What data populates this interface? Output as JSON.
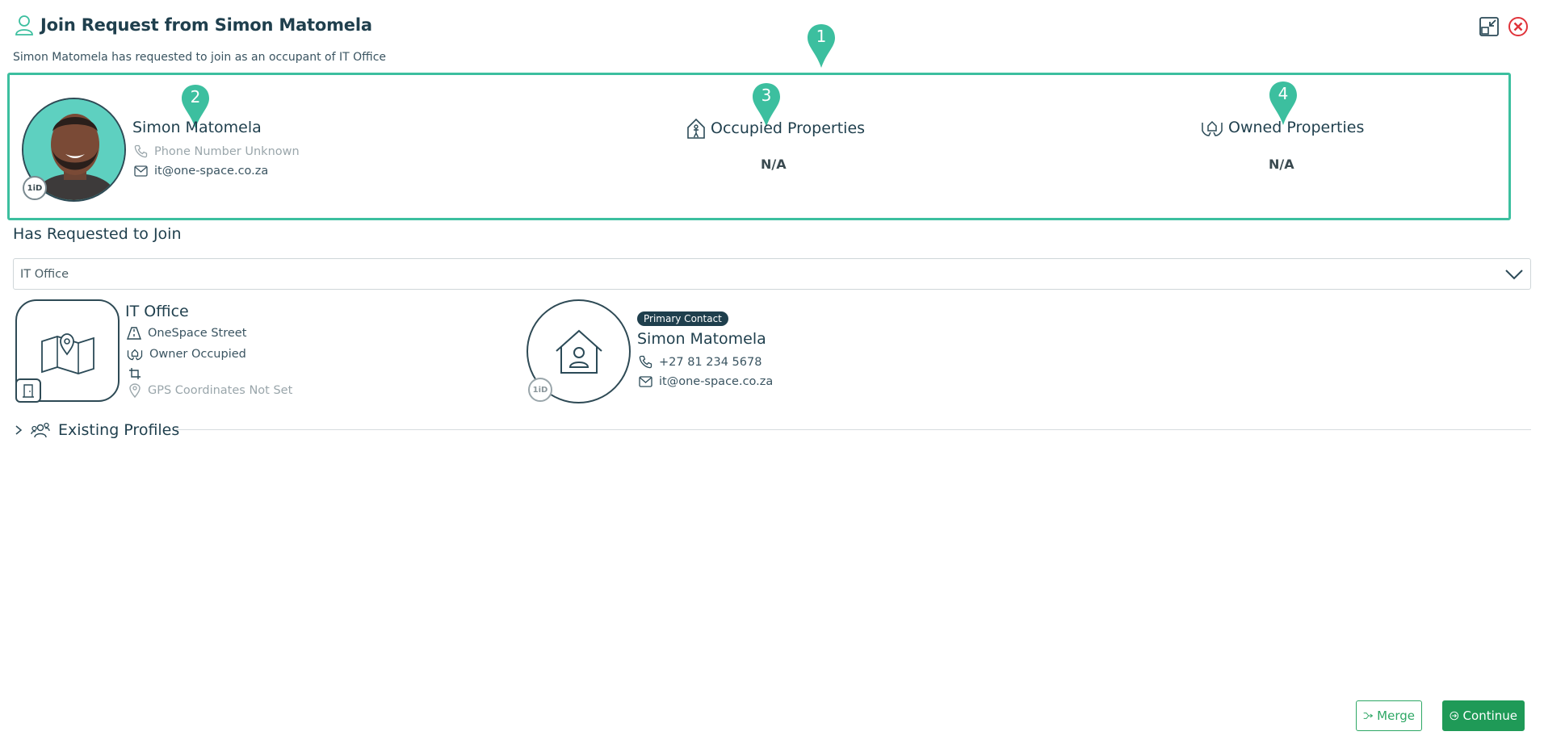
{
  "header": {
    "title": "Join Request from Simon Matomela",
    "subtitle": "Simon Matomela has requested to join as an occupant of IT Office"
  },
  "markers": [
    "1",
    "2",
    "3",
    "4"
  ],
  "requester": {
    "name": "Simon Matomela",
    "phone": "Phone Number Unknown",
    "email": "it@one-space.co.za",
    "badge": "1iD"
  },
  "stats": {
    "occupied_label": "Occupied Properties",
    "occupied_value": "N/A",
    "owned_label": "Owned Properties",
    "owned_value": "N/A"
  },
  "join_section": {
    "heading": "Has Requested to Join",
    "selected": "IT Office"
  },
  "property": {
    "name": "IT Office",
    "street": "OneSpace Street",
    "ownership": "Owner Occupied",
    "gps": "GPS Coordinates Not Set"
  },
  "contact": {
    "badge": "Primary Contact",
    "name": "Simon Matomela",
    "phone": "+27 81 234 5678",
    "email": "it@one-space.co.za",
    "id_badge": "1iD"
  },
  "existing_profiles": {
    "label": "Existing Profiles"
  },
  "actions": {
    "merge": "Merge",
    "continue": "Continue"
  },
  "colors": {
    "accent": "#3cbf9f",
    "primary_text": "#1f3f4d",
    "danger": "#e0333a",
    "success": "#1f9a57"
  }
}
